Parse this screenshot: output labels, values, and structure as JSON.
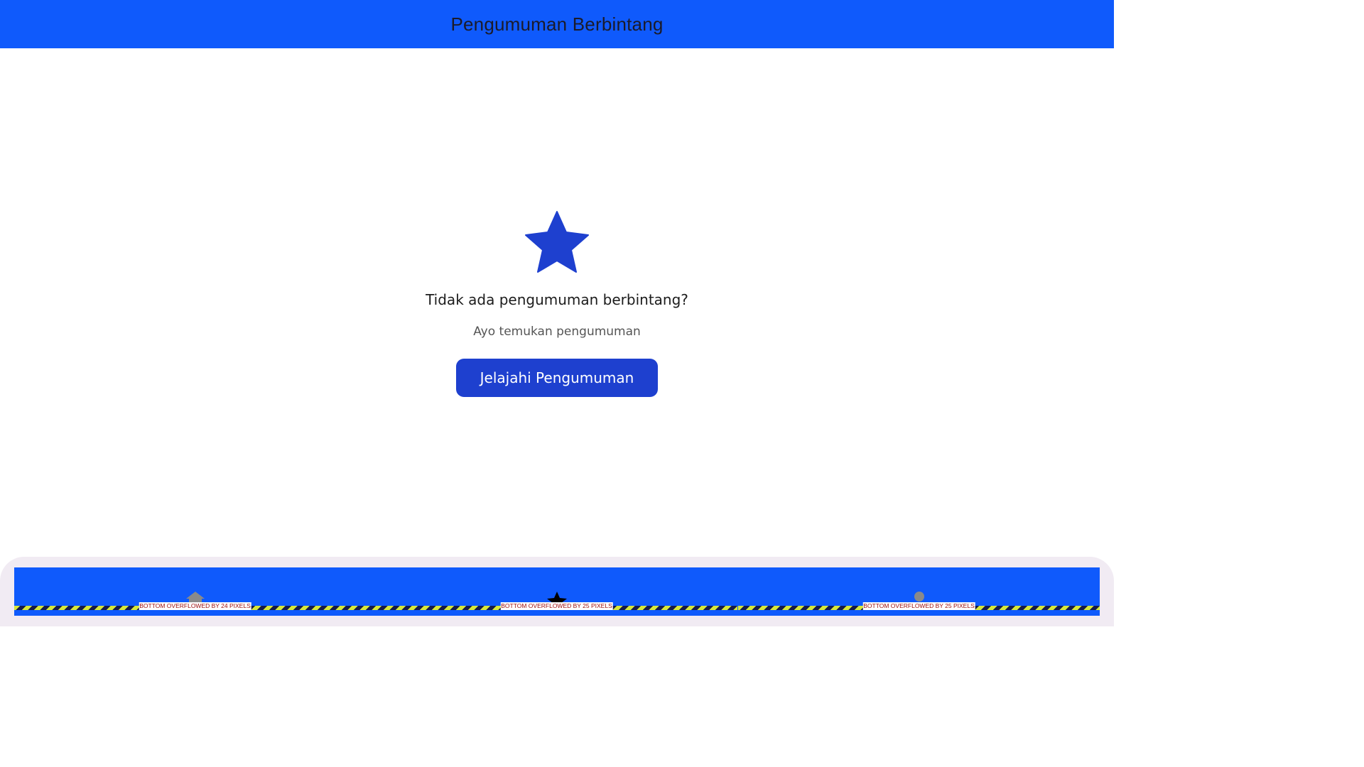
{
  "app_bar": {
    "title": "Pengumuman Berbintang"
  },
  "empty_state": {
    "icon": "star-icon",
    "title": "Tidak ada pengumuman berbintang?",
    "subtitle": "Ayo temukan pengumuman",
    "button_label": "Jelajahi Pengumuman"
  },
  "bottom_nav": {
    "items": [
      {
        "icon": "home-icon",
        "overflow_text": "BOTTOM OVERFLOWED BY 24 PIXELS",
        "selected": false
      },
      {
        "icon": "star-icon",
        "overflow_text": "BOTTOM OVERFLOWED BY 25 PIXELS",
        "selected": true
      },
      {
        "icon": "profile-icon",
        "overflow_text": "BOTTOM OVERFLOWED BY 25 PIXELS",
        "selected": false
      }
    ]
  },
  "colors": {
    "app_bar": "#0f5afc",
    "accent": "#1e40cf",
    "nav_background": "#f1ebf3",
    "overflow_stripe_yellow": "#d6e83a",
    "overflow_stripe_dark": "#151b4a",
    "overflow_text": "#9b0b0b"
  }
}
